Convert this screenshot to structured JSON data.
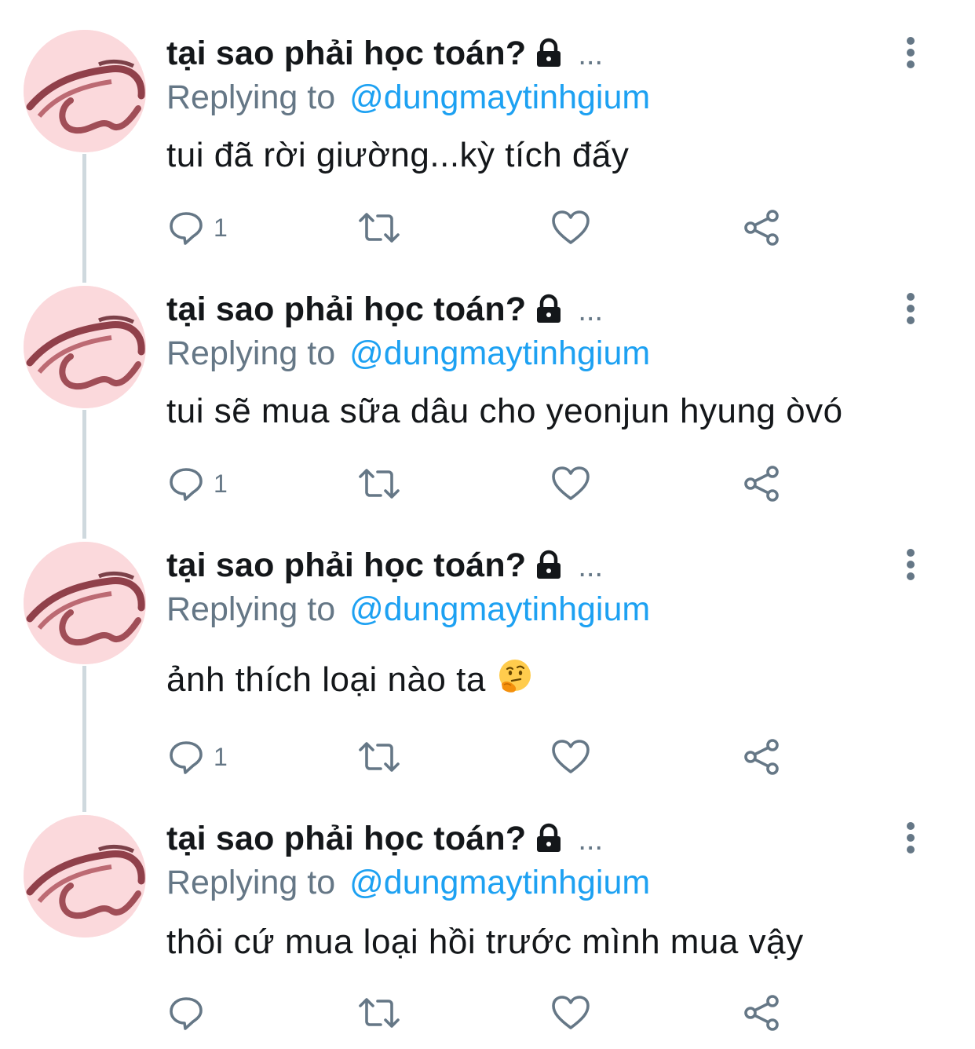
{
  "tweets": [
    {
      "author": "tại sao phải học toán?",
      "ellipsis": "...",
      "replying_prefix": "Replying to",
      "replying_handle": "@dungmaytinhgium",
      "text": "tui đã rời giường...kỳ tích đấy",
      "reply_count": "1"
    },
    {
      "author": "tại sao phải học toán?",
      "ellipsis": "...",
      "replying_prefix": "Replying to",
      "replying_handle": "@dungmaytinhgium",
      "text": "tui sẽ mua sữa dâu cho yeonjun hyung òvó",
      "reply_count": "1"
    },
    {
      "author": "tại sao phải học toán?",
      "ellipsis": "...",
      "replying_prefix": "Replying to",
      "replying_handle": "@dungmaytinhgium",
      "text": "ảnh thích loại nào ta",
      "emoji": "thinking-face",
      "reply_count": "1"
    },
    {
      "author": "tại sao phải học toán?",
      "ellipsis": "...",
      "replying_prefix": "Replying to",
      "replying_handle": "@dungmaytinhgium",
      "text": "thôi cứ mua loại hồi trước mình mua vậy",
      "reply_count": ""
    }
  ],
  "colors": {
    "text": "#14171a",
    "secondary": "#657786",
    "link": "#1da1f2",
    "thread_line": "#cfd9de",
    "avatar_bg": "#fbd9dc"
  },
  "icons": {
    "lock": "lock-icon",
    "more": "more-vertical-icon",
    "reply": "reply-icon",
    "retweet": "retweet-icon",
    "like": "heart-icon",
    "share": "share-icon"
  }
}
